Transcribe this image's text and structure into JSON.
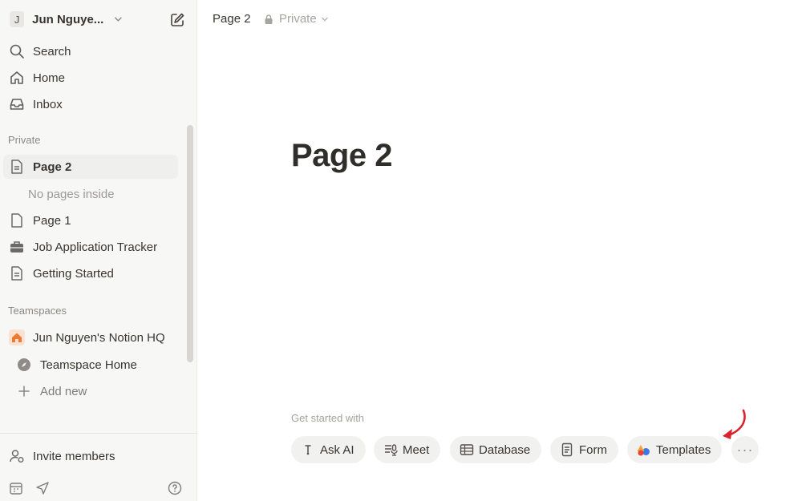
{
  "sidebar": {
    "workspace": {
      "initial": "J",
      "name": "Jun Nguye..."
    },
    "top_nav": [
      {
        "label": "Search",
        "icon": "search-icon"
      },
      {
        "label": "Home",
        "icon": "home-icon"
      },
      {
        "label": "Inbox",
        "icon": "inbox-icon"
      }
    ],
    "private_label": "Private",
    "private_pages": [
      {
        "label": "Page 2",
        "icon": "page-icon",
        "active": true
      },
      {
        "label": "Page 1",
        "icon": "page-icon"
      },
      {
        "label": "Job Application Tracker",
        "icon": "briefcase-icon"
      },
      {
        "label": "Getting Started",
        "icon": "page-icon"
      }
    ],
    "empty_note": "No pages inside",
    "teamspaces_label": "Teamspaces",
    "teamspaces": [
      {
        "label": "Jun Nguyen's Notion HQ",
        "icon": "house-icon"
      },
      {
        "label": "Teamspace Home",
        "icon": "compass-icon"
      },
      {
        "label": "Add new",
        "icon": "plus-icon"
      }
    ],
    "invite_label": "Invite members"
  },
  "breadcrumb": {
    "page": "Page 2",
    "visibility": "Private"
  },
  "page": {
    "title": "Page 2"
  },
  "get_started": {
    "label": "Get started with",
    "options": [
      {
        "label": "Ask AI",
        "icon": "ai-icon"
      },
      {
        "label": "Meet",
        "icon": "meeting-icon"
      },
      {
        "label": "Database",
        "icon": "table-icon"
      },
      {
        "label": "Form",
        "icon": "form-icon"
      },
      {
        "label": "Templates",
        "icon": "templates-icon"
      }
    ],
    "more": "···"
  },
  "colors": {
    "sidebar_bg": "#f7f7f5",
    "active_item_bg": "#efefed",
    "chip_bg": "#f1f1ef",
    "annotation_arrow": "#d9232d",
    "teamspace_icon": "#f0782f"
  }
}
